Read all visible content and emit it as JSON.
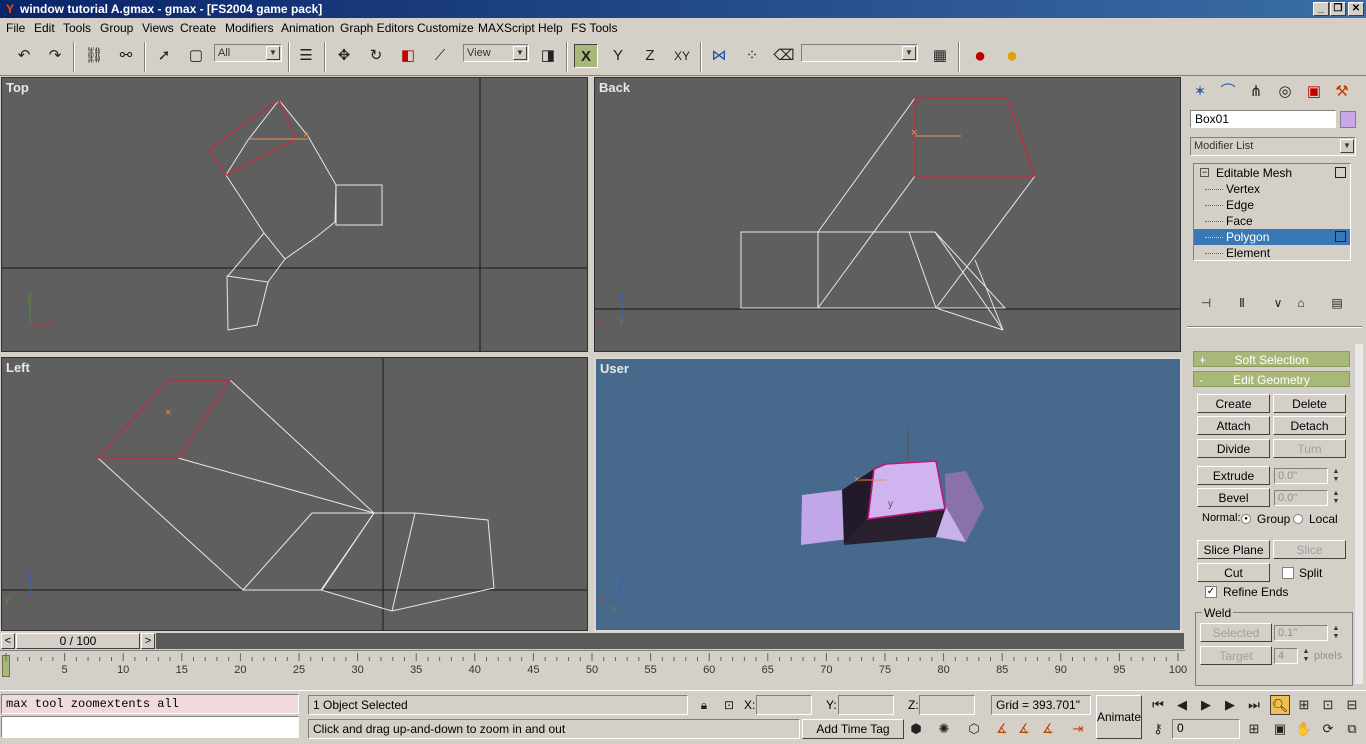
{
  "window": {
    "title": "window tutorial A.gmax - gmax - [FS2004 game pack]",
    "min": "_",
    "restore": "❐",
    "close": "✕"
  },
  "menu": [
    "File",
    "Edit",
    "Tools",
    "Group",
    "Views",
    "Create",
    "Modifiers",
    "Animation",
    "Graph Editors",
    "Customize",
    "MAXScript",
    "Help",
    "FS Tools"
  ],
  "toolbar": {
    "selection_filter": "All",
    "ref_coord": "View",
    "named_selection": "",
    "axis_x": "X",
    "axis_y": "Y",
    "axis_z": "Z",
    "axis_xy": "XY"
  },
  "viewports": {
    "top": "Top",
    "back": "Back",
    "left": "Left",
    "user": "User"
  },
  "command_panel": {
    "object_name": "Box01",
    "object_color": "#c9a7e8",
    "modifier_list": "Modifier List",
    "stack": [
      {
        "label": "Editable Mesh",
        "level": 0
      },
      {
        "label": "Vertex",
        "level": 1
      },
      {
        "label": "Edge",
        "level": 1
      },
      {
        "label": "Face",
        "level": 1
      },
      {
        "label": "Polygon",
        "level": 1
      },
      {
        "label": "Element",
        "level": 1
      }
    ],
    "rollouts": {
      "soft_selection": "Soft Selection",
      "soft_pm": "+",
      "edit_geometry": "Edit Geometry",
      "edit_pm": "-"
    },
    "buttons": {
      "create": "Create",
      "delete": "Delete",
      "attach": "Attach",
      "detach": "Detach",
      "divide": "Divide",
      "turn": "Turn",
      "extrude": "Extrude",
      "bevel": "Bevel",
      "slice_plane": "Slice Plane",
      "slice": "Slice",
      "cut": "Cut",
      "selected": "Selected",
      "target": "Target"
    },
    "extrude_value": "0.0\"",
    "bevel_value": "0.0\"",
    "normal_label": "Normal:",
    "normal_group": "Group",
    "normal_local": "Local",
    "split_label": "Split",
    "refine_ends_label": "Refine Ends",
    "weld_label": "Weld",
    "weld_selected_value": "0.1\"",
    "weld_target_value": "4",
    "pixels_label": "pixels"
  },
  "timeline": {
    "frame": "0 / 100",
    "prev": "<",
    "next": ">",
    "ticks": [
      "5",
      "10",
      "15",
      "20",
      "25",
      "30",
      "35",
      "40",
      "45",
      "50",
      "55",
      "60",
      "65",
      "70",
      "75",
      "80",
      "85",
      "90",
      "95",
      "100"
    ]
  },
  "status": {
    "listener": "max tool zoomextents all",
    "selection": "1 Object Selected",
    "prompt": "Click and drag up-and-down to zoom in and out",
    "x_label": "X:",
    "y_label": "Y:",
    "z_label": "Z:",
    "grid": "Grid = 393.701\"",
    "animate": "Animate",
    "add_time_tag": "Add Time Tag",
    "frame_field": "0"
  },
  "colors": {
    "viewport_bg": "#5f5f5f",
    "user_bg": "#476a8c",
    "rollout": "#a8b878",
    "highlight": "#3a78b4",
    "selected_edge": "#c8283c",
    "wire": "#e8e8e8"
  }
}
